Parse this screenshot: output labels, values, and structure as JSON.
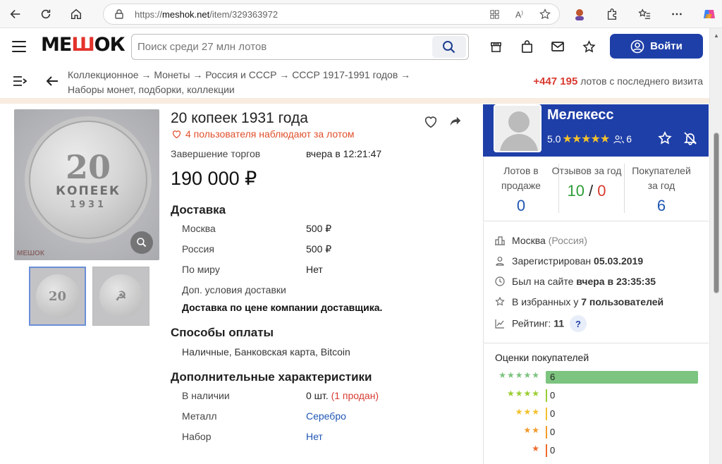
{
  "browser": {
    "url_prefix": "https://",
    "url_host": "meshok.net",
    "url_path": "/item/329363972"
  },
  "site": {
    "logo": "МЕШОК",
    "search_placeholder": "Поиск среди 27 млн лотов",
    "login_label": "Войти"
  },
  "breadcrumb": {
    "text": "Коллекционное → Монеты → Россия и СССР → СССР 1917-1991 годов → Наборы монет, подборки, коллекции"
  },
  "since_visit": {
    "count": "+447 195",
    "text": " лотов с последнего визита"
  },
  "gallery": {
    "coin_value": "20",
    "coin_word": "КОПЕЕК",
    "coin_year": "1931",
    "watermark": "МЕШОК"
  },
  "item": {
    "title": "20 копеек 1931 года",
    "watchers": "4 пользователя наблюдают за лотом",
    "end_label": "Завершение торгов",
    "end_value": "вчера в 12:21:47",
    "price": "190 000 ₽"
  },
  "delivery": {
    "title": "Доставка",
    "rows": [
      {
        "label": "Москва",
        "value": "500 ₽"
      },
      {
        "label": "Россия",
        "value": "500 ₽"
      },
      {
        "label": "По миру",
        "value": "Нет"
      }
    ],
    "extra_label": "Доп. условия доставки",
    "extra_value": "Доставка по цене компании доставщика."
  },
  "payment": {
    "title": "Способы оплаты",
    "value": "Наличные, Банковская карта, Bitcoin"
  },
  "characteristics": {
    "title": "Дополнительные характеристики",
    "stock_label": "В наличии",
    "stock_value": "0 шт.",
    "stock_sold": "(1 продан)",
    "metal_label": "Металл",
    "metal_value": "Серебро",
    "set_label": "Набор",
    "set_value": "Нет"
  },
  "seller": {
    "name": "Мелекесс",
    "rating": "5.0",
    "stars": "★★★★★",
    "followers": "6",
    "stats": {
      "lots_label": "Лотов в продаже",
      "lots_value": "0",
      "reviews_label": "Отзывов за год",
      "reviews_pos": "10",
      "reviews_sep": " / ",
      "reviews_neg": "0",
      "buyers_label": "Покупателей за год",
      "buyers_value": "6"
    },
    "city": "Москва",
    "country": "(Россия)",
    "registered_label": "Зарегистрирован ",
    "registered_value": "05.03.2019",
    "last_seen_label": "Был на сайте ",
    "last_seen_value": "вчера в 23:35:35",
    "fav_label": "В избранных у ",
    "fav_value": "7 пользователей",
    "rating_label": "Рейтинг: ",
    "rating_value": "11",
    "rating_help": "?"
  },
  "ratings": {
    "title": "Оценки покупателей",
    "rows": [
      {
        "stars": "★★★★★",
        "count": "6",
        "color": "#7cc47f"
      },
      {
        "stars": "★★★★",
        "count": "0",
        "color": "#9acd32"
      },
      {
        "stars": "★★★",
        "count": "0",
        "color": "#f2c12e"
      },
      {
        "stars": "★★",
        "count": "0",
        "color": "#f39a2b"
      },
      {
        "stars": "★",
        "count": "0",
        "color": "#ef6b2b"
      }
    ]
  }
}
